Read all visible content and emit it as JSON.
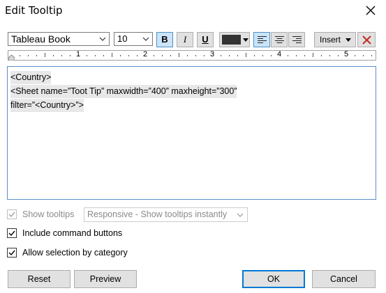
{
  "window": {
    "title": "Edit Tooltip"
  },
  "toolbar": {
    "font_family": "Tableau Book",
    "font_size": "10",
    "bold_label": "B",
    "italic_label": "I",
    "underline_label": "U",
    "text_color": "#333333",
    "insert_label": "Insert"
  },
  "ruler": {
    "numbers": [
      "1",
      "2",
      "3",
      "4",
      "5"
    ]
  },
  "editor": {
    "lines": [
      "<Country>",
      "<Sheet name=”Toot Tip” maxwidth=”400” maxheight=”300”",
      "filter=”<Country>”>"
    ]
  },
  "options": {
    "show_tooltips": {
      "label": "Show tooltips",
      "checked": true,
      "enabled": false
    },
    "tooltip_mode": "Responsive - Show tooltips instantly",
    "include_command_buttons": {
      "label": "Include command buttons",
      "checked": true
    },
    "allow_selection": {
      "label": "Allow selection by category",
      "checked": true
    }
  },
  "buttons": {
    "reset": "Reset",
    "preview": "Preview",
    "ok": "OK",
    "cancel": "Cancel"
  },
  "colors": {
    "accent": "#0078d7",
    "active_toggle": "#cce4f7",
    "delete_red": "#c42b1c"
  }
}
